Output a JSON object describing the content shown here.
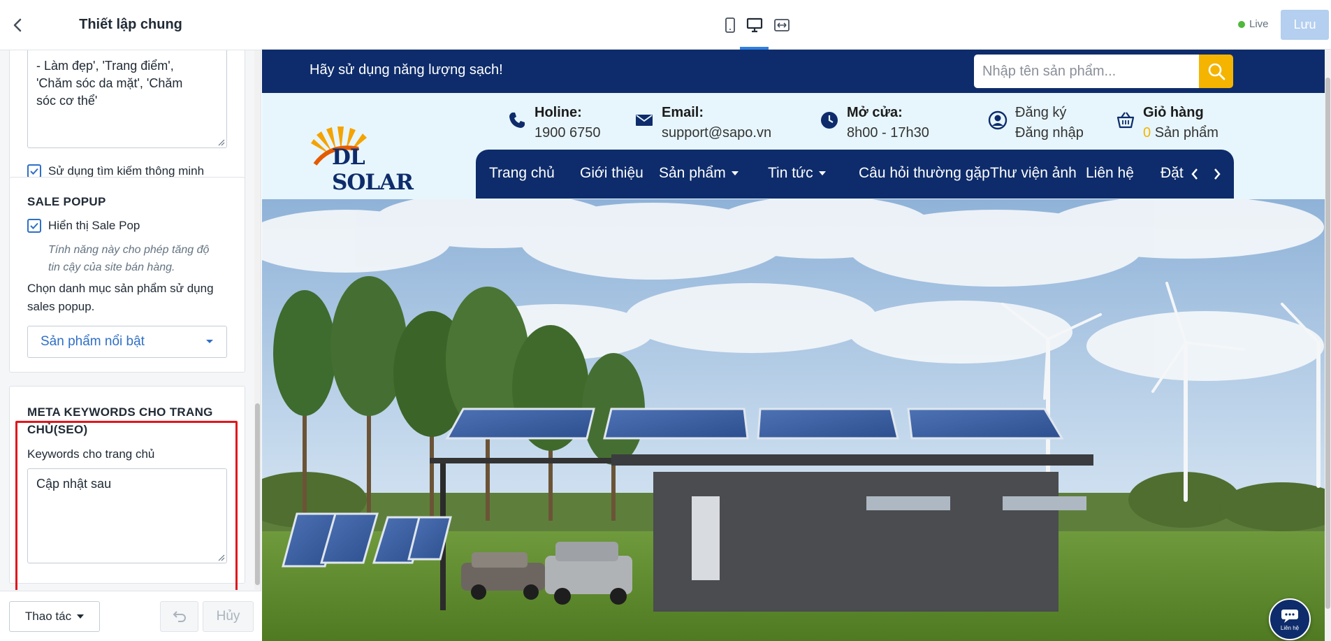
{
  "sidebar": {
    "title": "Thiết lập chung",
    "keywords_textarea": {
      "line1": "- Làm đẹp', 'Trang điểm',",
      "line2": "'Chăm sóc da mặt', 'Chăm",
      "line3": "sóc cơ thể'"
    },
    "smart_search_label": "Sử dụng tìm kiếm thông minh",
    "sale_popup": {
      "title": "SALE POPUP",
      "show_label": "Hiển thị Sale Pop",
      "help_line1": "Tính năng này cho phép tăng độ",
      "help_line2": "tin cậy của site bán hàng.",
      "category_label_line1": "Chọn danh mục sản phẩm sử dụng",
      "category_label_line2": "sales popup.",
      "selected_category": "Sản phẩm nổi bật"
    },
    "meta": {
      "title_line1": "META KEYWORDS CHO TRANG",
      "title_line2": "CHỦ(SEO)",
      "field_label": "Keywords cho trang chủ",
      "field_value": "Cập nhật sau"
    },
    "footer": {
      "actions_label": "Thao tác",
      "cancel_label": "Hủy"
    }
  },
  "toolbar": {
    "live_label": "Live",
    "save_label": "Lưu"
  },
  "site": {
    "promo_text": "Hãy sử dụng năng lượng sạch!",
    "search_placeholder": "Nhập tên sản phẩm...",
    "logo_text": "DL SOLAR",
    "hotline_label": "Holine:",
    "hotline_value": "1900 6750",
    "email_label": "Email:",
    "email_value": "support@sapo.vn",
    "hours_label": "Mở cửa:",
    "hours_value": "8h00 - 17h30",
    "register_label": "Đăng ký",
    "login_label": "Đăng nhập",
    "cart_label": "Giỏ hàng",
    "cart_count": "0",
    "cart_unit": "Sản phẩm",
    "nav": [
      "Trang chủ",
      "Giới thiệu",
      "Sản phẩm",
      "Tin tức",
      "Câu hỏi thường gặp",
      "Thư viện ảnh",
      "Liên hệ",
      "Đặt"
    ],
    "chat_label": "Liên hệ"
  },
  "colors": {
    "navy": "#0e2c6b",
    "accent_yellow": "#f4b400",
    "highlight_red": "#e1161d",
    "checkbox_blue": "#2f6fc7"
  },
  "icons": [
    "chevron-left-icon",
    "mobile-icon",
    "desktop-icon",
    "fullwidth-icon",
    "search-icon",
    "phone-icon",
    "email-icon",
    "clock-icon",
    "user-icon",
    "cart-icon",
    "chat-icon",
    "undo-icon"
  ]
}
